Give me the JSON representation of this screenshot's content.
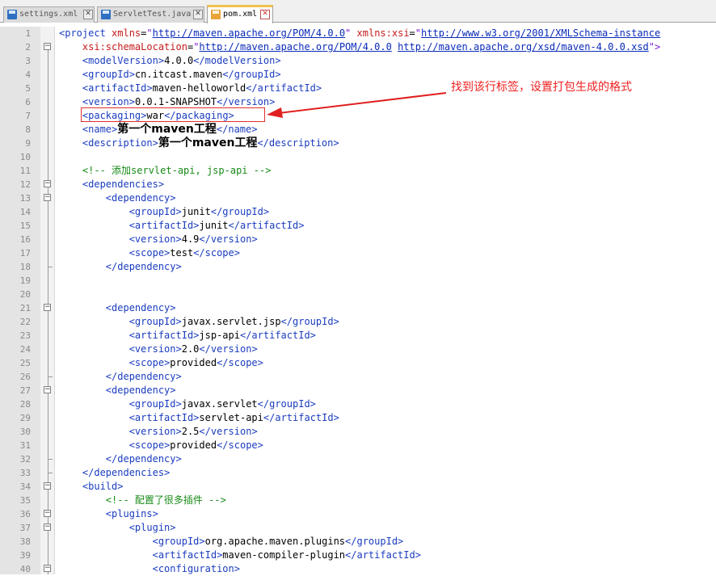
{
  "tabs": [
    {
      "label": "settings.xml",
      "icon": "save-icon"
    },
    {
      "label": "ServletTest.java",
      "icon": "save-icon"
    },
    {
      "label": "pom.xml",
      "icon": "save-icon",
      "active": true
    }
  ],
  "annotation": "找到该行标签，设置打包生成的格式",
  "lines": [
    {
      "n": "1",
      "segs": [
        [
          "tag",
          "<project "
        ],
        [
          "attr",
          "xmlns"
        ],
        [
          "txt",
          "="
        ],
        [
          "val",
          "\""
        ],
        [
          "url",
          "http://maven.apache.org/POM/4.0.0"
        ],
        [
          "val",
          "\""
        ],
        [
          "txt",
          " "
        ],
        [
          "attr",
          "xmlns:xsi"
        ],
        [
          "txt",
          "="
        ],
        [
          "val",
          "\""
        ],
        [
          "url",
          "http://www.w3.org/2001/XMLSchema-instance"
        ]
      ]
    },
    {
      "n": "2",
      "segs": [
        [
          "txt",
          "    "
        ],
        [
          "attr",
          "xsi:schemaLocation"
        ],
        [
          "txt",
          "="
        ],
        [
          "val",
          "\""
        ],
        [
          "url",
          "http://maven.apache.org/POM/4.0.0"
        ],
        [
          "txt",
          " "
        ],
        [
          "url",
          "http://maven.apache.org/xsd/maven-4.0.0.xsd"
        ],
        [
          "val",
          "\">"
        ]
      ]
    },
    {
      "n": "3",
      "segs": [
        [
          "txt",
          "    "
        ],
        [
          "tag",
          "<modelVersion>"
        ],
        [
          "txt",
          "4.0.0"
        ],
        [
          "tag",
          "</modelVersion>"
        ]
      ]
    },
    {
      "n": "4",
      "segs": [
        [
          "txt",
          "    "
        ],
        [
          "tag",
          "<groupId>"
        ],
        [
          "txt",
          "cn.itcast.maven"
        ],
        [
          "tag",
          "</groupId>"
        ]
      ]
    },
    {
      "n": "5",
      "segs": [
        [
          "txt",
          "    "
        ],
        [
          "tag",
          "<artifactId>"
        ],
        [
          "txt",
          "maven-helloworld"
        ],
        [
          "tag",
          "</artifactId>"
        ]
      ]
    },
    {
      "n": "6",
      "segs": [
        [
          "txt",
          "    "
        ],
        [
          "tag",
          "<version>"
        ],
        [
          "txt",
          "0.0.1-SNAPSHOT"
        ],
        [
          "tag",
          "</version>"
        ]
      ]
    },
    {
      "n": "7",
      "segs": [
        [
          "txt",
          "    "
        ],
        [
          "tag",
          "<packaging>"
        ],
        [
          "txt",
          "war"
        ],
        [
          "tag",
          "</packaging>"
        ]
      ]
    },
    {
      "n": "8",
      "segs": [
        [
          "txt",
          "    "
        ],
        [
          "tag",
          "<name>"
        ],
        [
          "bold",
          "第一个maven工程"
        ],
        [
          "tag",
          "</name>"
        ]
      ]
    },
    {
      "n": "9",
      "segs": [
        [
          "txt",
          "    "
        ],
        [
          "tag",
          "<description>"
        ],
        [
          "bold",
          "第一个maven工程"
        ],
        [
          "tag",
          "</description>"
        ]
      ]
    },
    {
      "n": "10",
      "segs": []
    },
    {
      "n": "11",
      "segs": [
        [
          "txt",
          "    "
        ],
        [
          "cmt",
          "<!-- 添加servlet-api, jsp-api -->"
        ]
      ]
    },
    {
      "n": "12",
      "segs": [
        [
          "txt",
          "    "
        ],
        [
          "tag",
          "<dependencies>"
        ]
      ]
    },
    {
      "n": "13",
      "segs": [
        [
          "txt",
          "        "
        ],
        [
          "tag",
          "<dependency>"
        ]
      ]
    },
    {
      "n": "14",
      "segs": [
        [
          "txt",
          "            "
        ],
        [
          "tag",
          "<groupId>"
        ],
        [
          "txt",
          "junit"
        ],
        [
          "tag",
          "</groupId>"
        ]
      ]
    },
    {
      "n": "15",
      "segs": [
        [
          "txt",
          "            "
        ],
        [
          "tag",
          "<artifactId>"
        ],
        [
          "txt",
          "junit"
        ],
        [
          "tag",
          "</artifactId>"
        ]
      ]
    },
    {
      "n": "16",
      "segs": [
        [
          "txt",
          "            "
        ],
        [
          "tag",
          "<version>"
        ],
        [
          "txt",
          "4.9"
        ],
        [
          "tag",
          "</version>"
        ]
      ]
    },
    {
      "n": "17",
      "segs": [
        [
          "txt",
          "            "
        ],
        [
          "tag",
          "<scope>"
        ],
        [
          "txt",
          "test"
        ],
        [
          "tag",
          "</scope>"
        ]
      ]
    },
    {
      "n": "18",
      "segs": [
        [
          "txt",
          "        "
        ],
        [
          "tag",
          "</dependency>"
        ]
      ]
    },
    {
      "n": "19",
      "segs": []
    },
    {
      "n": "20",
      "segs": []
    },
    {
      "n": "21",
      "segs": [
        [
          "txt",
          "        "
        ],
        [
          "tag",
          "<dependency>"
        ]
      ]
    },
    {
      "n": "22",
      "segs": [
        [
          "txt",
          "            "
        ],
        [
          "tag",
          "<groupId>"
        ],
        [
          "txt",
          "javax.servlet.jsp"
        ],
        [
          "tag",
          "</groupId>"
        ]
      ]
    },
    {
      "n": "23",
      "segs": [
        [
          "txt",
          "            "
        ],
        [
          "tag",
          "<artifactId>"
        ],
        [
          "txt",
          "jsp-api"
        ],
        [
          "tag",
          "</artifactId>"
        ]
      ]
    },
    {
      "n": "24",
      "segs": [
        [
          "txt",
          "            "
        ],
        [
          "tag",
          "<version>"
        ],
        [
          "txt",
          "2.0"
        ],
        [
          "tag",
          "</version>"
        ]
      ]
    },
    {
      "n": "25",
      "segs": [
        [
          "txt",
          "            "
        ],
        [
          "tag",
          "<scope>"
        ],
        [
          "txt",
          "provided"
        ],
        [
          "tag",
          "</scope>"
        ]
      ]
    },
    {
      "n": "26",
      "segs": [
        [
          "txt",
          "        "
        ],
        [
          "tag",
          "</dependency>"
        ]
      ]
    },
    {
      "n": "27",
      "segs": [
        [
          "txt",
          "        "
        ],
        [
          "tag",
          "<dependency>"
        ]
      ]
    },
    {
      "n": "28",
      "segs": [
        [
          "txt",
          "            "
        ],
        [
          "tag",
          "<groupId>"
        ],
        [
          "txt",
          "javax.servlet"
        ],
        [
          "tag",
          "</groupId>"
        ]
      ]
    },
    {
      "n": "29",
      "segs": [
        [
          "txt",
          "            "
        ],
        [
          "tag",
          "<artifactId>"
        ],
        [
          "txt",
          "servlet-api"
        ],
        [
          "tag",
          "</artifactId>"
        ]
      ]
    },
    {
      "n": "30",
      "segs": [
        [
          "txt",
          "            "
        ],
        [
          "tag",
          "<version>"
        ],
        [
          "txt",
          "2.5"
        ],
        [
          "tag",
          "</version>"
        ]
      ]
    },
    {
      "n": "31",
      "segs": [
        [
          "txt",
          "            "
        ],
        [
          "tag",
          "<scope>"
        ],
        [
          "txt",
          "provided"
        ],
        [
          "tag",
          "</scope>"
        ]
      ]
    },
    {
      "n": "32",
      "segs": [
        [
          "txt",
          "        "
        ],
        [
          "tag",
          "</dependency>"
        ]
      ]
    },
    {
      "n": "33",
      "segs": [
        [
          "txt",
          "    "
        ],
        [
          "tag",
          "</dependencies>"
        ]
      ]
    },
    {
      "n": "34",
      "segs": [
        [
          "txt",
          "    "
        ],
        [
          "tag",
          "<build>"
        ]
      ]
    },
    {
      "n": "35",
      "segs": [
        [
          "txt",
          "        "
        ],
        [
          "cmt",
          "<!-- 配置了很多插件 -->"
        ]
      ]
    },
    {
      "n": "36",
      "segs": [
        [
          "txt",
          "        "
        ],
        [
          "tag",
          "<plugins>"
        ]
      ]
    },
    {
      "n": "37",
      "segs": [
        [
          "txt",
          "            "
        ],
        [
          "tag",
          "<plugin>"
        ]
      ]
    },
    {
      "n": "38",
      "segs": [
        [
          "txt",
          "                "
        ],
        [
          "tag",
          "<groupId>"
        ],
        [
          "txt",
          "org.apache.maven.plugins"
        ],
        [
          "tag",
          "</groupId>"
        ]
      ]
    },
    {
      "n": "39",
      "segs": [
        [
          "txt",
          "                "
        ],
        [
          "tag",
          "<artifactId>"
        ],
        [
          "txt",
          "maven-compiler-plugin"
        ],
        [
          "tag",
          "</artifactId>"
        ]
      ]
    },
    {
      "n": "40",
      "segs": [
        [
          "txt",
          "                "
        ],
        [
          "tag",
          "<configuration>"
        ]
      ]
    }
  ]
}
